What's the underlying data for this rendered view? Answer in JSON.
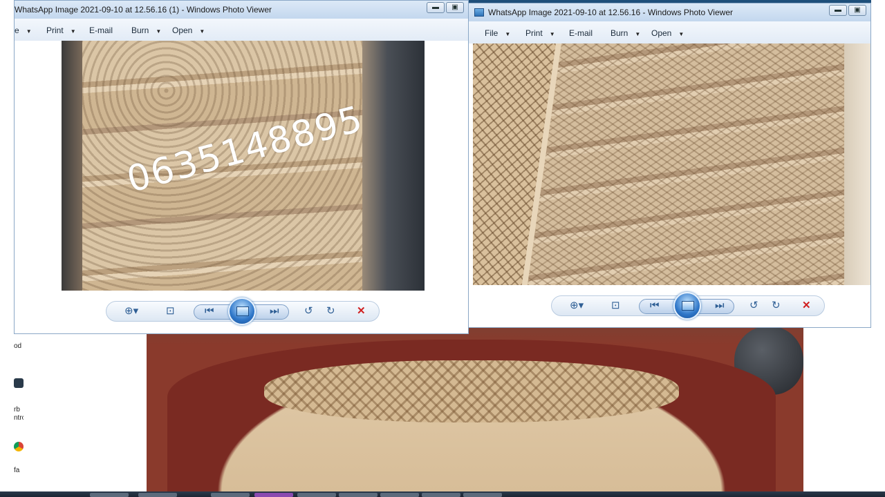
{
  "window_left": {
    "title": "WhatsApp Image 2021-09-10 at 12.56.16 (1) - Windows Photo Viewer",
    "menu": {
      "file": "e",
      "print": "Print",
      "email": "E-mail",
      "burn": "Burn",
      "open": "Open"
    },
    "watermark": "0635148895"
  },
  "window_right": {
    "title": "WhatsApp Image 2021-09-10 at 12.56.16 - Windows Photo Viewer",
    "menu": {
      "file": "File",
      "print": "Print",
      "email": "E-mail",
      "burn": "Burn",
      "open": "Open"
    }
  },
  "desktop": {
    "left_labels": [
      "od",
      "rb",
      "ntro",
      "fa"
    ]
  },
  "colors": {
    "titlebar": "#c3d7ee",
    "delete_red": "#d02020",
    "wood": "#d8c2a2",
    "table_red": "#7a2a22"
  },
  "icons": {
    "zoom": "magnifier-icon",
    "actual_size": "actual-size-icon",
    "previous": "previous-icon",
    "slideshow": "slideshow-icon",
    "next": "next-icon",
    "rotate_ccw": "rotate-ccw-icon",
    "rotate_cw": "rotate-cw-icon",
    "delete": "delete-icon"
  }
}
